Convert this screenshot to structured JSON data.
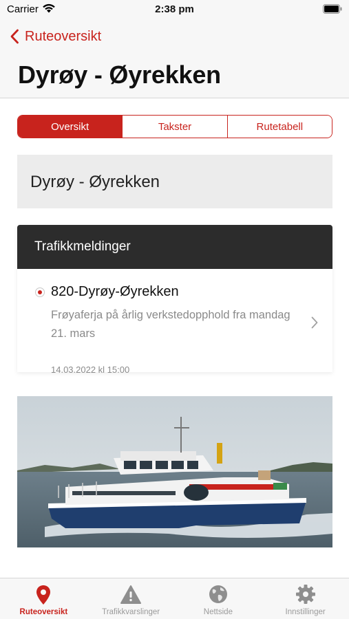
{
  "status_bar": {
    "carrier": "Carrier",
    "time": "2:38 pm"
  },
  "nav": {
    "back_label": "Ruteoversikt",
    "title": "Dyrøy - Øyrekken"
  },
  "segments": [
    {
      "label": "Oversikt",
      "active": true
    },
    {
      "label": "Takster",
      "active": false
    },
    {
      "label": "Rutetabell",
      "active": false
    }
  ],
  "route_panel": {
    "title": "Dyrøy - Øyrekken"
  },
  "traffic": {
    "header": "Trafikkmeldinger",
    "messages": [
      {
        "title": "820-Dyrøy-Øyrekken",
        "description": "Frøyaferja på årlig verkstedopphold fra mandag 21. mars",
        "date": "14.03.2022 kl 15:00"
      }
    ]
  },
  "tabs": [
    {
      "label": "Ruteoversikt",
      "icon": "location-pin-icon",
      "active": true
    },
    {
      "label": "Trafikkvarslinger",
      "icon": "warning-icon",
      "active": false
    },
    {
      "label": "Nettside",
      "icon": "globe-icon",
      "active": false
    },
    {
      "label": "Innstillinger",
      "icon": "gear-icon",
      "active": false
    }
  ],
  "colors": {
    "accent": "#c8231d",
    "header_dark": "#2c2c2c",
    "panel_gray": "#ececec",
    "muted_text": "#8a8a8a",
    "tab_inactive": "#9a9a9a"
  }
}
